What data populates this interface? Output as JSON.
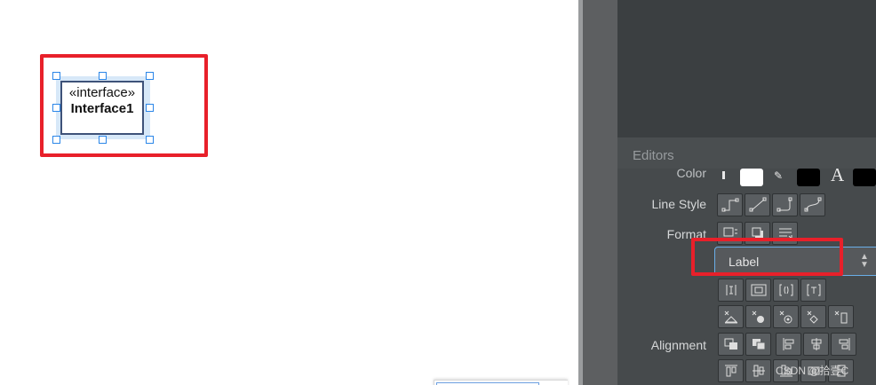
{
  "canvas": {
    "shape": {
      "stereotype": "«interface»",
      "name": "Interface1"
    }
  },
  "format_panel": {
    "section_title": "Editors",
    "rows": {
      "color_label": "Color",
      "line_style_label": "Line Style",
      "format_label": "Format",
      "alignment_label": "Alignment"
    },
    "label_select": {
      "value": "Label"
    },
    "colors": {
      "accent": "#e8202a",
      "selection": "#2b86e8",
      "panel_bg": "#464a4c"
    }
  },
  "watermark": "CSDN @拾壹C"
}
